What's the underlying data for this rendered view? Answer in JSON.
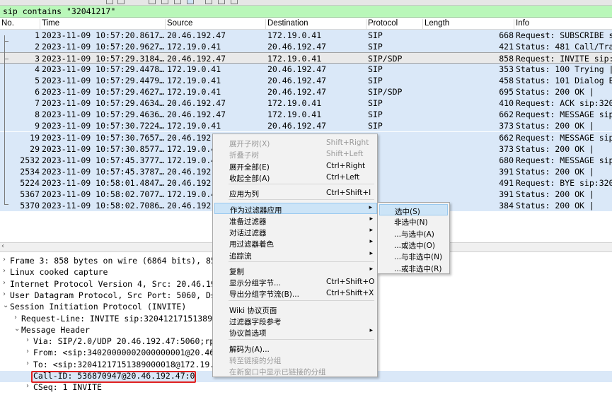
{
  "display_filter": "sip contains \"32041217\"",
  "columns": {
    "no": "No.",
    "time": "Time",
    "source": "Source",
    "destination": "Destination",
    "protocol": "Protocol",
    "length": "Length",
    "info": "Info"
  },
  "packets": [
    {
      "no": "1",
      "time": "2023-11-09 10:57:20.8617…",
      "source": "20.46.192.47",
      "destination": "172.19.0.41",
      "protocol": "SIP",
      "length": "668",
      "info": "Request: SUBSCRIBE si"
    },
    {
      "no": "2",
      "time": "2023-11-09 10:57:20.9627…",
      "source": "172.19.0.41",
      "destination": "20.46.192.47",
      "protocol": "SIP",
      "length": "421",
      "info": "Status: 481 Call/Tra"
    },
    {
      "no": "3",
      "time": "2023-11-09 10:57:29.3184…",
      "source": "20.46.192.47",
      "destination": "172.19.0.41",
      "protocol": "SIP/SDP",
      "length": "858",
      "info": "Request: INVITE sip:"
    },
    {
      "no": "4",
      "time": "2023-11-09 10:57:29.4478…",
      "source": "172.19.0.41",
      "destination": "20.46.192.47",
      "protocol": "SIP",
      "length": "353",
      "info": "Status: 100 Trying |"
    },
    {
      "no": "5",
      "time": "2023-11-09 10:57:29.4479…",
      "source": "172.19.0.41",
      "destination": "20.46.192.47",
      "protocol": "SIP",
      "length": "458",
      "info": "Status: 101 Dialog E"
    },
    {
      "no": "6",
      "time": "2023-11-09 10:57:29.4627…",
      "source": "172.19.0.41",
      "destination": "20.46.192.47",
      "protocol": "SIP/SDP",
      "length": "695",
      "info": "Status: 200 OK |"
    },
    {
      "no": "7",
      "time": "2023-11-09 10:57:29.4634…",
      "source": "20.46.192.47",
      "destination": "172.19.0.41",
      "protocol": "SIP",
      "length": "410",
      "info": "Request: ACK sip:320"
    },
    {
      "no": "8",
      "time": "2023-11-09 10:57:29.4636…",
      "source": "20.46.192.47",
      "destination": "172.19.0.41",
      "protocol": "SIP",
      "length": "662",
      "info": "Request: MESSAGE sip"
    },
    {
      "no": "9",
      "time": "2023-11-09 10:57:30.7224…",
      "source": "172.19.0.41",
      "destination": "20.46.192.47",
      "protocol": "SIP",
      "length": "373",
      "info": "Status: 200 OK |"
    },
    {
      "no": "19",
      "time": "2023-11-09 10:57:30.7657…",
      "source": "20.46.192",
      "destination": "",
      "protocol": "",
      "length": "662",
      "info": "Request: MESSAGE sip"
    },
    {
      "no": "29",
      "time": "2023-11-09 10:57:30.8577…",
      "source": "172.19.0.4",
      "destination": "",
      "protocol": "",
      "length": "373",
      "info": "Status: 200 OK |"
    },
    {
      "no": "2532",
      "time": "2023-11-09 10:57:45.3777…",
      "source": "172.19.0.4",
      "destination": "",
      "protocol": "",
      "length": "680",
      "info": "Request: MESSAGE sip"
    },
    {
      "no": "2534",
      "time": "2023-11-09 10:57:45.3787…",
      "source": "20.46.192",
      "destination": "",
      "protocol": "",
      "length": "391",
      "info": "Status: 200 OK |"
    },
    {
      "no": "5224",
      "time": "2023-11-09 10:58:01.4847…",
      "source": "20.46.192",
      "destination": "",
      "protocol": "",
      "length": "491",
      "info": "Request: BYE sip:320"
    },
    {
      "no": "5367",
      "time": "2023-11-09 10:58:02.7077…",
      "source": "172.19.0.4",
      "destination": "",
      "protocol": "",
      "length": "391",
      "info": "Status: 200 OK |"
    },
    {
      "no": "5370",
      "time": "2023-11-09 10:58:02.7086…",
      "source": "20.46.192",
      "destination": "",
      "protocol": "",
      "length": "384",
      "info": "Status: 200 OK |"
    }
  ],
  "selected_packet": "3",
  "details": [
    {
      "arrow": "›",
      "text": "Frame 3: 858 bytes on wire (6864 bits), 85"
    },
    {
      "arrow": "›",
      "text": "Linux cooked capture"
    },
    {
      "arrow": "›",
      "text": "Internet Protocol Version 4, Src: 20.46.19"
    },
    {
      "arrow": "›",
      "text": "User Datagram Protocol, Src Port: 5060, Ds"
    },
    {
      "arrow": "⌄",
      "text": "Session Initiation Protocol (INVITE)"
    },
    {
      "arrow": "›",
      "text": "Request-Line: INVITE sip:32041217151389000"
    },
    {
      "arrow": "⌄",
      "text": "Message Header"
    },
    {
      "arrow": "›",
      "text": "Via: SIP/2.0/UDP 20.46.192.47:5060;rp"
    },
    {
      "arrow": "›",
      "text": "From: <sip:34020000002000000001@20.46"
    },
    {
      "arrow": "›",
      "text": "To: <sip:32041217151389000018@172.19."
    },
    {
      "arrow": "",
      "text": "Call-ID: 536870947@20.46.192.47:0"
    },
    {
      "arrow": "›",
      "text": "CSeq: 1 INVITE"
    }
  ],
  "context_menu": {
    "items": [
      {
        "label": "展开子树(X)",
        "shortcut": "Shift+Right",
        "disabled": true
      },
      {
        "label": "折叠子树",
        "shortcut": "Shift+Left",
        "disabled": true
      },
      {
        "label": "展开全部(E)",
        "shortcut": "Ctrl+Right"
      },
      {
        "label": "收起全部(A)",
        "shortcut": "Ctrl+Left"
      },
      {
        "label": "应用为列",
        "shortcut": "Ctrl+Shift+I"
      },
      {
        "label": "作为过滤器应用",
        "shortcut": "",
        "submenu": true,
        "active": true
      },
      {
        "label": "准备过滤器",
        "shortcut": "",
        "submenu": true
      },
      {
        "label": "对话过滤器",
        "shortcut": "",
        "submenu": true
      },
      {
        "label": "用过滤器着色",
        "shortcut": "",
        "submenu": true
      },
      {
        "label": "追踪流",
        "shortcut": "",
        "submenu": true
      },
      {
        "label": "复制",
        "shortcut": "",
        "submenu": true
      },
      {
        "label": "显示分组字节...",
        "shortcut": "Ctrl+Shift+O"
      },
      {
        "label": "导出分组字节流(B)...",
        "shortcut": "Ctrl+Shift+X"
      },
      {
        "label": "Wiki 协议页面",
        "shortcut": ""
      },
      {
        "label": "过滤器字段参考",
        "shortcut": ""
      },
      {
        "label": "协议首选项",
        "shortcut": "",
        "submenu": true
      },
      {
        "label": "解码为(A)...",
        "shortcut": ""
      },
      {
        "label": "转至链接的分组",
        "shortcut": "",
        "disabled": true
      },
      {
        "label": "在新窗口中显示已链接的分组",
        "shortcut": "",
        "disabled": true
      }
    ],
    "submenu_arrow": "▸"
  },
  "filter_submenu": {
    "items": [
      {
        "label": "选中(S)",
        "active": true
      },
      {
        "label": "非选中(N)"
      },
      {
        "label": "...与选中(A)"
      },
      {
        "label": "...或选中(O)"
      },
      {
        "label": "...与非选中(N)"
      },
      {
        "label": "...或非选中(R)"
      }
    ]
  },
  "colors": {
    "filter_bg": "#b9f7b9",
    "row_bg": "#dae8f8",
    "selected_row_bg": "#e9e9e9",
    "menu_highlight": "#cce4f7",
    "callid_box": "#e02020"
  }
}
